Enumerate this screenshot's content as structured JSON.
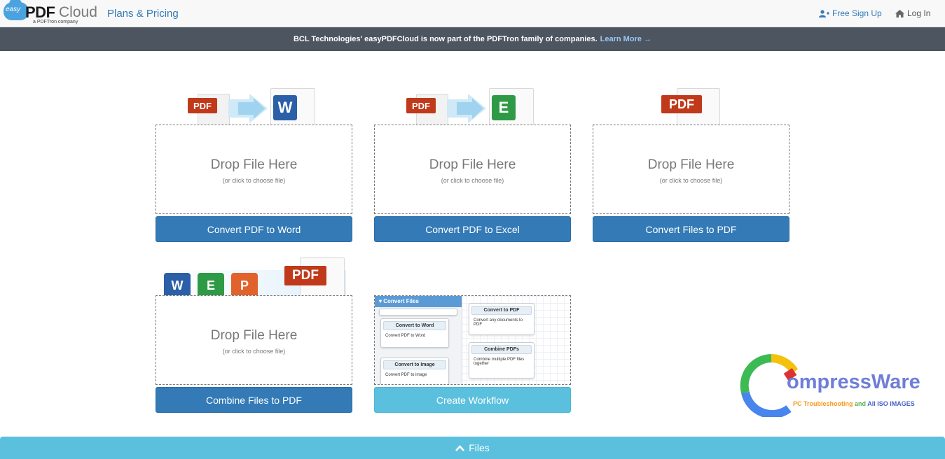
{
  "header": {
    "logo": {
      "easy": "easy",
      "pdf": "PDF",
      "cloud": "Cloud",
      "sub": "a PDFTron company"
    },
    "plans_label": "Plans & Pricing",
    "signup_label": "Free Sign Up",
    "login_label": "Log In",
    "icons": {
      "signup": "user-plus-icon",
      "login": "home-icon"
    }
  },
  "banner": {
    "text": "BCL Technologies' easyPDFCloud is now part of the PDFTron family of companies.",
    "link_label": "Learn More →"
  },
  "cards": [
    {
      "drop_title": "Drop File Here",
      "drop_sub": "(or click to choose file)",
      "button": "Convert PDF to Word"
    },
    {
      "drop_title": "Drop File Here",
      "drop_sub": "(or click to choose file)",
      "button": "Convert PDF to Excel"
    },
    {
      "drop_title": "Drop File Here",
      "drop_sub": "(or click to choose file)",
      "button": "Convert Files to PDF"
    },
    {
      "drop_title": "Drop File Here",
      "drop_sub": "(or click to choose file)",
      "button": "Combine Files to PDF"
    },
    {
      "button": "Create Workflow"
    }
  ],
  "illustrations": {
    "pdf_badge": "PDF",
    "word_letter": "W",
    "excel_letter": "E",
    "ppt_letter": "P"
  },
  "workflow_preview": {
    "panel_title": "Convert Files",
    "items": [
      {
        "title": "Convert to Word",
        "desc": "Convert PDF to Word"
      },
      {
        "title": "Convert to Image",
        "desc": "Convert PDF to image"
      },
      {
        "title": "Convert to PDF",
        "desc": "Convert any documents to PDF"
      },
      {
        "title": "Combine PDFs",
        "desc": "Combine multiple PDF files together"
      }
    ]
  },
  "watermark": {
    "brand_a": "ompress",
    "brand_b": "Ware",
    "tag_a": "PC Troubleshooting",
    "tag_b": "and",
    "tag_c": "All ISO IMAGES"
  },
  "footer": {
    "files_label": "Files",
    "icon": "chevron-up-icon"
  },
  "colors": {
    "primary": "#337ab7",
    "info": "#5bc0de",
    "banner": "#4d5561",
    "pdf_red": "#c0391b"
  }
}
